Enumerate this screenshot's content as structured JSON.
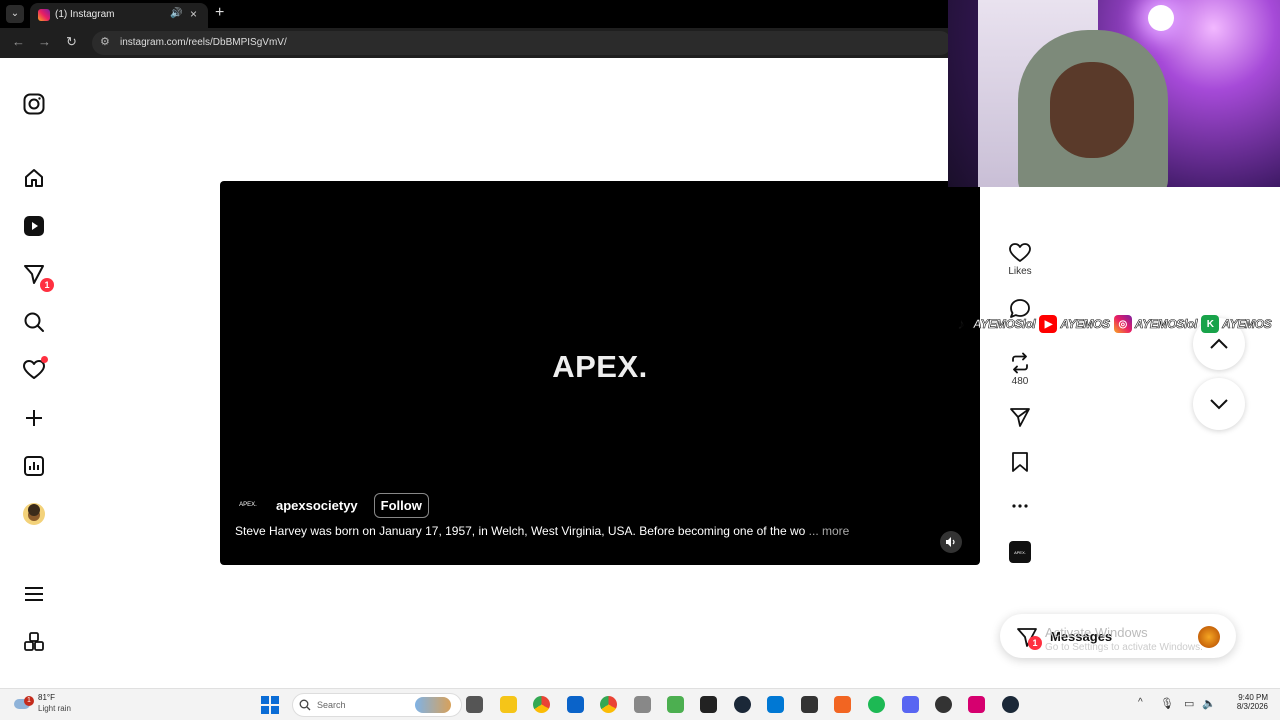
{
  "browser": {
    "tab_title": "(1) Instagram",
    "url": "instagram.com/reels/DbBMPISgVmV/"
  },
  "reel": {
    "brand_text": "APEX.",
    "author_avatar_text": "APEX.",
    "username": "apexsocietyy",
    "follow_label": "Follow",
    "caption": "Steve Harvey was born on January 17, 1957, in Welch, West Virginia, USA. Before becoming one of the wo",
    "caption_more": "... more"
  },
  "actions": {
    "likes_label": "Likes",
    "reposts_count": "480",
    "audio_thumb_text": "APEX."
  },
  "sidebar": {
    "messages_badge": "1"
  },
  "messages": {
    "label": "Messages",
    "badge": "1"
  },
  "overlay": {
    "activate_title": "Activate Windows",
    "activate_sub": "Go to Settings to activate Windows.",
    "socials": [
      {
        "platform": "tiktok",
        "handle": "AYEMOSlol"
      },
      {
        "platform": "youtube",
        "handle": "AYEMOS"
      },
      {
        "platform": "instagram",
        "handle": "AYEMOSlol"
      },
      {
        "platform": "kick",
        "handle": "AYEMOS"
      }
    ]
  },
  "taskbar": {
    "weather_temp": "81°F",
    "weather_desc": "Light rain",
    "weather_badge": "1",
    "search_placeholder": "Search",
    "time": "9:40 PM",
    "date": "8/3/2026"
  },
  "colors": {
    "accent_red": "#ff3040",
    "reel_bg": "#000000"
  }
}
